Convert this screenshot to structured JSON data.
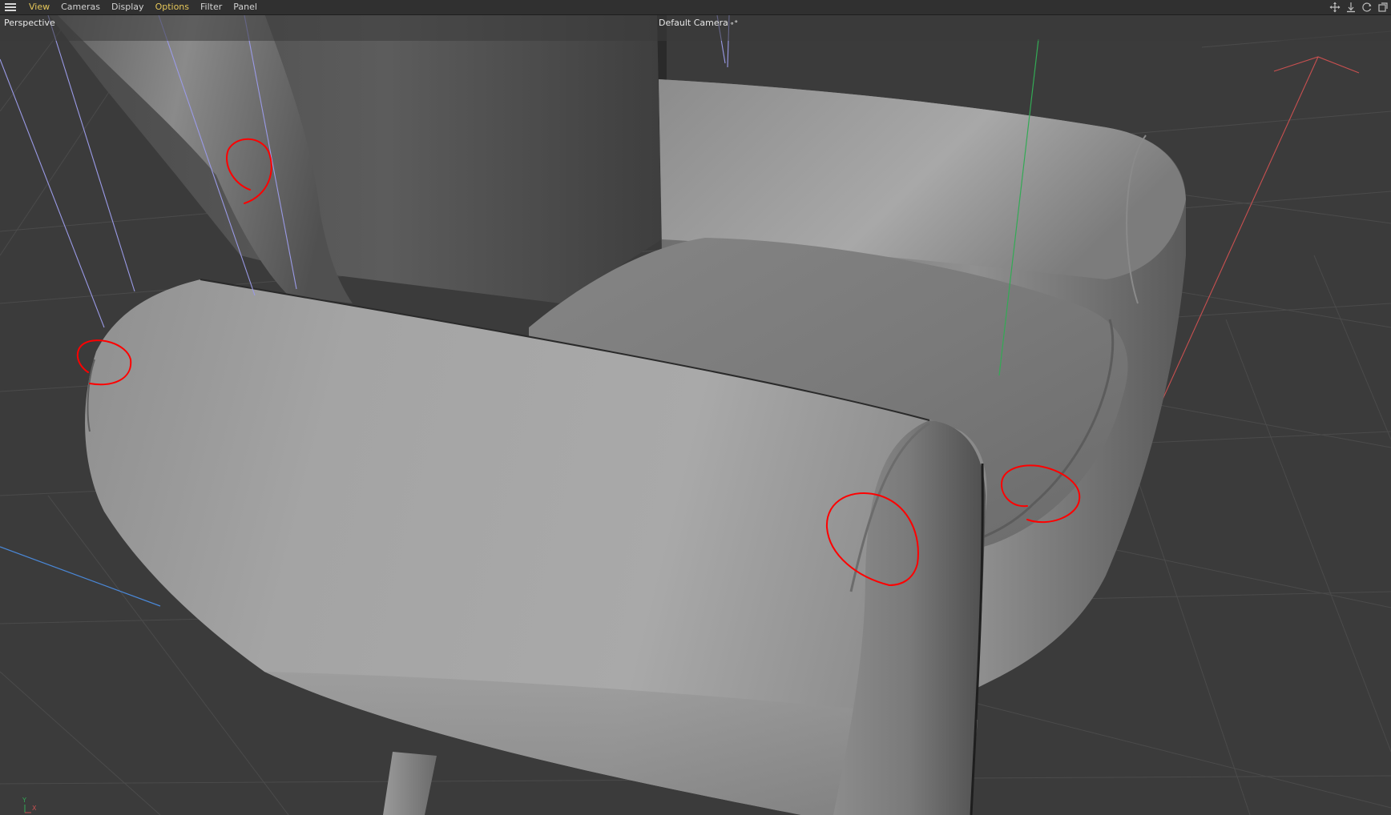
{
  "menu": {
    "items": [
      {
        "label": "View",
        "highlighted": true
      },
      {
        "label": "Cameras",
        "highlighted": false
      },
      {
        "label": "Display",
        "highlighted": false
      },
      {
        "label": "Options",
        "highlighted": true
      },
      {
        "label": "Filter",
        "highlighted": false
      },
      {
        "label": "Panel",
        "highlighted": false
      }
    ],
    "nav_icons": [
      "move-view-icon",
      "dolly-view-icon",
      "rotate-view-icon",
      "maximize-view-icon"
    ]
  },
  "viewport": {
    "view_name": "Perspective",
    "camera_name": "Default Camera",
    "camera_dots": "∘°"
  },
  "axis_gizmo": {
    "y_label": "Y",
    "x_label": "X"
  },
  "colors": {
    "menu_bg": "#303030",
    "menu_text": "#d2d2d2",
    "menu_highlight": "#e6c75a",
    "viewport_bg": "#3a3a3a",
    "grid": "#4a4a4a",
    "annotation_red": "#ff0000",
    "axis_x": "#c85050",
    "axis_y": "#33aa55",
    "axis_z": "#4a88d8",
    "guide_lines": "#9a9ae6"
  }
}
